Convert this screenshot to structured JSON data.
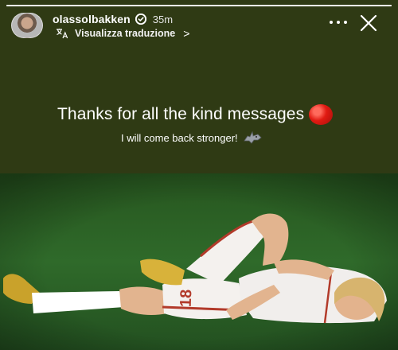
{
  "story": {
    "progress": 1.0,
    "header": {
      "username": "olassolbakken",
      "time": "35m",
      "translate_label": "Visualizza traduzione",
      "translate_chevron": ">"
    },
    "caption": {
      "main": "Thanks for all the kind messages",
      "sub": "I will come back stronger!"
    },
    "photo": {
      "jersey_number": "18"
    }
  },
  "colors": {
    "panel": "#2f3a14",
    "pitch": "#2f6a2a",
    "accent_red": "#e11a12"
  }
}
